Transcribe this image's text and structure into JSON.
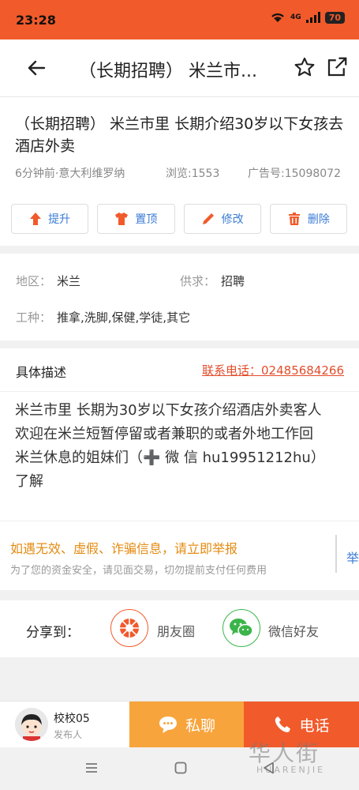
{
  "status_bar": {
    "time": "23:28",
    "network": "4G",
    "battery": "70"
  },
  "nav": {
    "title": "（长期招聘） 米兰市..."
  },
  "post": {
    "title": "（长期招聘） 米兰市里 长期介绍30岁以下女孩去酒店外卖",
    "posted": "6分钟前·意大利维罗纳",
    "views": "浏览:1553",
    "ad_id": "广告号:15098072"
  },
  "actions": {
    "promote": "提升",
    "pin": "置顶",
    "edit": "修改",
    "delete": "删除"
  },
  "info": {
    "region_label": "地区：",
    "region_value": "米兰",
    "type_label": "供求：",
    "type_value": "招聘",
    "job_label": "工种：",
    "job_value": "推拿,洗脚,保健,学徒,其它"
  },
  "description": {
    "header": "具体描述",
    "phone": "联系电话：02485684266",
    "body": "米兰市里 长期为30岁以下女孩介绍酒店外卖客人　欢迎在米兰短暂停留或者兼职的或者外地工作回米兰休息的姐妹们（➕ 微 信 hu19951212hu）了解"
  },
  "warning": {
    "line1": "如遇无效、虚假、诈骗信息，请立即举报",
    "line2": "为了您的资金安全，请见面交易，切勿提前支付任何费用",
    "report": "举"
  },
  "share": {
    "label": "分享到：",
    "moments": "朋友圈",
    "wechat_friends": "微信好友"
  },
  "bottom": {
    "username": "校校05",
    "role": "发布人",
    "chat": "私聊",
    "call": "电话"
  },
  "watermark": {
    "text": "华人街",
    "sub": "HUARENJIE"
  },
  "colors": {
    "accent": "#f15a2b",
    "chat": "#f8a43c",
    "link": "#3a7bd5",
    "warning": "#e48b12"
  }
}
